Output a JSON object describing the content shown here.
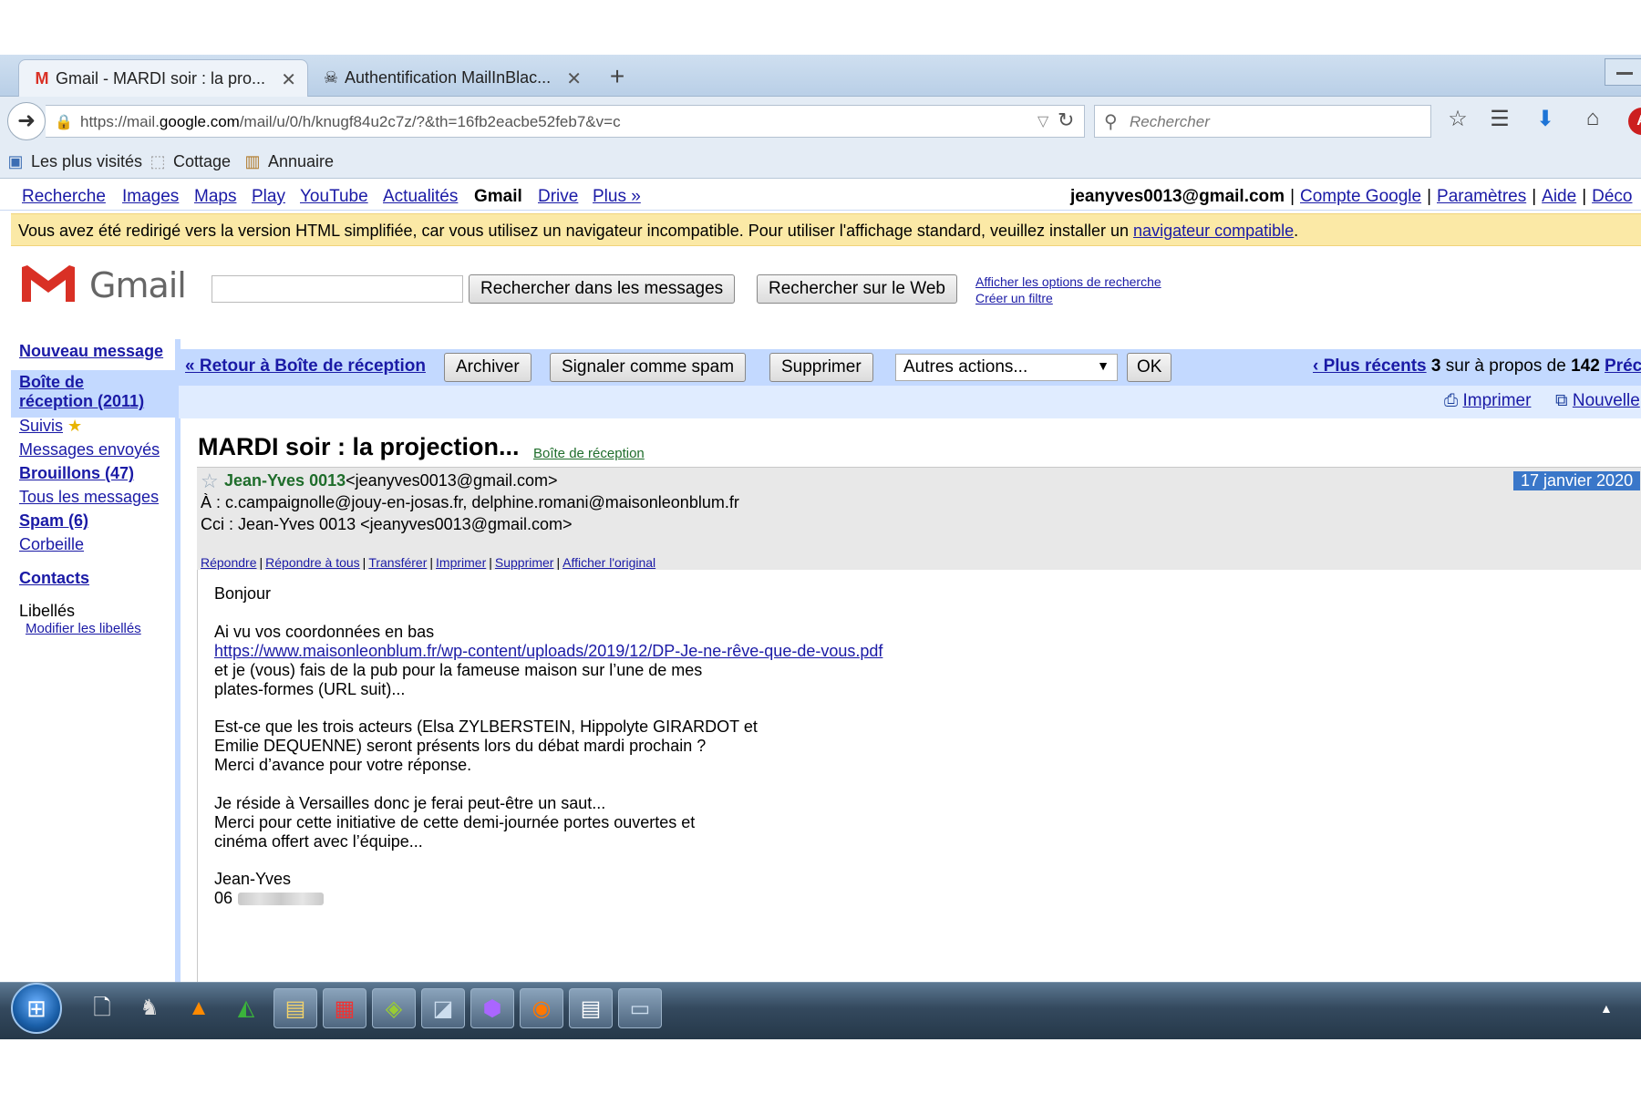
{
  "browser": {
    "tabs": [
      {
        "title": "Gmail - MARDI soir : la pro...",
        "icon": "gmail-icon"
      },
      {
        "title": "Authentification MailInBlac...",
        "icon": "pirate-icon"
      }
    ],
    "url_prefix": "https://mail.",
    "url_domain": "google.com",
    "url_rest": "/mail/u/0/h/knugf84u2c7z/?&th=16fb2eacbe52feb7&v=c",
    "search_placeholder": "Recherche",
    "search_placeholder_full": "Rechercher",
    "bookmarks": [
      "Les plus visités",
      "Cottage",
      "Annuaire"
    ]
  },
  "gbar": {
    "links": [
      "Recherche",
      "Images",
      "Maps",
      "Play",
      "YouTube",
      "Actualités"
    ],
    "current": "Gmail",
    "links_after": [
      "Drive",
      "Plus »"
    ],
    "account_email": "jeanyves0013@gmail.com",
    "account_links": [
      "Compte Google",
      "Paramètres",
      "Aide",
      "Déco"
    ]
  },
  "notice": {
    "text": "Vous avez été redirigé vers la version HTML simplifiée, car vous utilisez un navigateur incompatible. Pour utiliser l'affichage standard, veuillez installer un ",
    "link": "navigateur compatible",
    "end": "."
  },
  "search": {
    "logo_text": "Gmail",
    "btn_messages": "Rechercher dans les messages",
    "btn_web": "Rechercher sur le Web",
    "link_options": "Afficher les options de recherche",
    "link_filter": "Créer un filtre"
  },
  "leftnav": {
    "compose": "Nouveau message",
    "inbox_line1": "Boîte de",
    "inbox_line2": "réception (2011)",
    "starred": "Suivis",
    "sent": "Messages envoyés",
    "drafts": "Brouillons (47)",
    "all": "Tous les messages",
    "spam": "Spam (6)",
    "trash": "Corbeille",
    "contacts": "Contacts",
    "labels": "Libellés",
    "edit_labels": "Modifier les libellés"
  },
  "actionbar": {
    "back": "« Retour à Boîte de réception",
    "archive": "Archiver",
    "spam": "Signaler comme spam",
    "delete": "Supprimer",
    "more": "Autres actions...",
    "ok": "OK",
    "newer": "‹ Plus récents",
    "count_n": "3",
    "count_text": "sur à propos de",
    "count_total": "142",
    "older": "Préc",
    "print": "Imprimer",
    "new_window": "Nouvelle"
  },
  "message": {
    "subject": "MARDI soir : la projection...",
    "label": "Boîte de réception",
    "from_name": "Jean-Yves 0013",
    "from_email": "<jeanyves0013@gmail.com>",
    "date": "17 janvier 2020",
    "to": "À : c.campaignolle@jouy-en-josas.fr, delphine.romani@maisonleonblum.fr",
    "cc": "Cci : Jean-Yves 0013 <jeanyves0013@gmail.com>",
    "actions": [
      "Répondre",
      "Répondre à tous",
      "Transférer",
      "Imprimer",
      "Supprimer",
      "Afficher l'original"
    ],
    "body": {
      "l1": "Bonjour",
      "l2": "Ai vu vos coordonnées en bas",
      "link": "https://www.maisonleonblum.fr/wp-content/uploads/2019/12/DP-Je-ne-rêve-que-de-vous.pdf",
      "l3": " et je (vous) fais de la pub pour la fameuse maison sur l’une de mes",
      "l4": "plates-formes (URL suit)...",
      "l5": "Est-ce que les trois acteurs (Elsa ZYLBERSTEIN, Hippolyte GIRARDOT et",
      "l6": "Emilie DEQUENNE)  seront présents lors du débat mardi prochain ?",
      "l7": "Merci d’avance pour votre réponse.",
      "l8": "Je réside à Versailles donc je ferai peut-être un saut...",
      "l9": "Merci pour cette initiative de cette demi-journée portes ouvertes et",
      "l10": "cinéma offert avec l’équipe...",
      "l11": "Jean-Yves",
      "l12": "06"
    }
  },
  "colors": {
    "gmail_red": "#d93025",
    "link": "#1a1aa6",
    "green": "#1f6d2b",
    "action_bar": "#c3d9ff",
    "notice": "#fbe9a6"
  }
}
